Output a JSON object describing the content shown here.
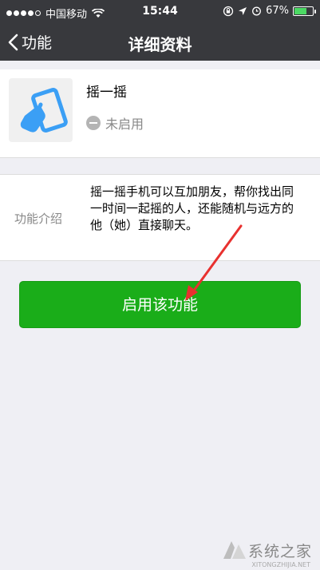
{
  "status_bar": {
    "carrier": "中国移动",
    "time": "15:44",
    "battery": "67%",
    "battery_level": 0.67
  },
  "nav": {
    "back_label": "功能",
    "title": "详细资料"
  },
  "feature": {
    "name": "摇一摇",
    "status": "未启用"
  },
  "intro": {
    "label": "功能介绍",
    "text": "摇一摇手机可以互加朋友，帮你找出同一时间一起摇的人，还能随机与远方的他（她）直接聊天。"
  },
  "enable_button": {
    "label": "启用该功能"
  },
  "watermark": {
    "text": "系统之家",
    "sub": "XITONGZHIJIA.NET"
  },
  "colors": {
    "bar_bg": "#38393d",
    "page_bg": "#efeff4",
    "accent_green": "#1aad19",
    "arrow_red": "#e8312f",
    "icon_blue": "#3b9ff5"
  }
}
